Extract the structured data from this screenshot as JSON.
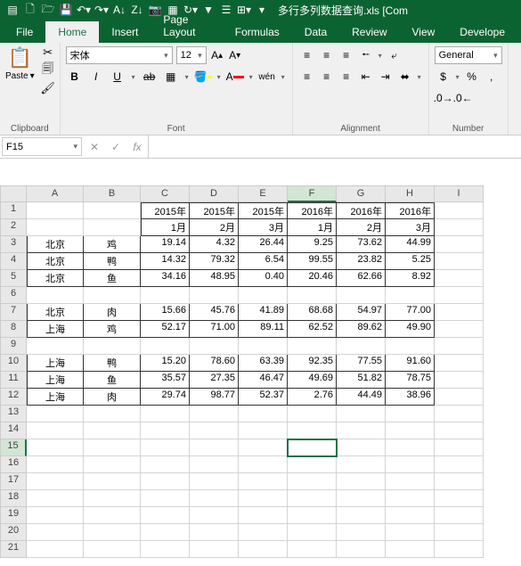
{
  "title": "多行多列数据查询.xls  [Com",
  "tabs": [
    "File",
    "Home",
    "Insert",
    "Page Layout",
    "Formulas",
    "Data",
    "Review",
    "View",
    "Develope"
  ],
  "active_tab": 1,
  "groups": {
    "clipboard": "Clipboard",
    "font": "Font",
    "alignment": "Alignment",
    "number": "Number"
  },
  "clipboard": {
    "paste": "Paste"
  },
  "font": {
    "name": "宋体",
    "size": "12"
  },
  "number": {
    "format": "General"
  },
  "name_box": "F15",
  "formula": "",
  "columns": [
    "A",
    "B",
    "C",
    "D",
    "E",
    "F",
    "G",
    "H",
    "I"
  ],
  "selected_col": "F",
  "selected_row": 15,
  "rows": [
    {
      "n": 1,
      "A": "",
      "B": "",
      "C": "2015年",
      "D": "2015年",
      "E": "2015年",
      "F": "2016年",
      "G": "2016年",
      "H": "2016年"
    },
    {
      "n": 2,
      "A": "",
      "B": "",
      "C": "1月",
      "D": "2月",
      "E": "3月",
      "F": "1月",
      "G": "2月",
      "H": "3月"
    },
    {
      "n": 3,
      "A": "北京",
      "B": "鸡",
      "C": "19.14",
      "D": "4.32",
      "E": "26.44",
      "F": "9.25",
      "G": "73.62",
      "H": "44.99"
    },
    {
      "n": 4,
      "A": "北京",
      "B": "鸭",
      "C": "14.32",
      "D": "79.32",
      "E": "6.54",
      "F": "99.55",
      "G": "23.82",
      "H": "5.25"
    },
    {
      "n": 5,
      "A": "北京",
      "B": "鱼",
      "C": "34.16",
      "D": "48.95",
      "E": "0.40",
      "F": "20.46",
      "G": "62.66",
      "H": "8.92"
    },
    {
      "n": 6
    },
    {
      "n": 7,
      "A": "北京",
      "B": "肉",
      "C": "15.66",
      "D": "45.76",
      "E": "41.89",
      "F": "68.68",
      "G": "54.97",
      "H": "77.00"
    },
    {
      "n": 8,
      "A": "上海",
      "B": "鸡",
      "C": "52.17",
      "D": "71.00",
      "E": "89.11",
      "F": "62.52",
      "G": "89.62",
      "H": "49.90"
    },
    {
      "n": 9
    },
    {
      "n": 10,
      "A": "上海",
      "B": "鸭",
      "C": "15.20",
      "D": "78.60",
      "E": "63.39",
      "F": "92.35",
      "G": "77.55",
      "H": "91.60"
    },
    {
      "n": 11,
      "A": "上海",
      "B": "鱼",
      "C": "35.57",
      "D": "27.35",
      "E": "46.47",
      "F": "49.69",
      "G": "51.82",
      "H": "78.75"
    },
    {
      "n": 12,
      "A": "上海",
      "B": "肉",
      "C": "29.74",
      "D": "98.77",
      "E": "52.37",
      "F": "2.76",
      "G": "44.49",
      "H": "38.96"
    },
    {
      "n": 13
    },
    {
      "n": 14
    },
    {
      "n": 15
    },
    {
      "n": 16
    },
    {
      "n": 17
    },
    {
      "n": 18
    },
    {
      "n": 19
    },
    {
      "n": 20
    },
    {
      "n": 21
    }
  ]
}
